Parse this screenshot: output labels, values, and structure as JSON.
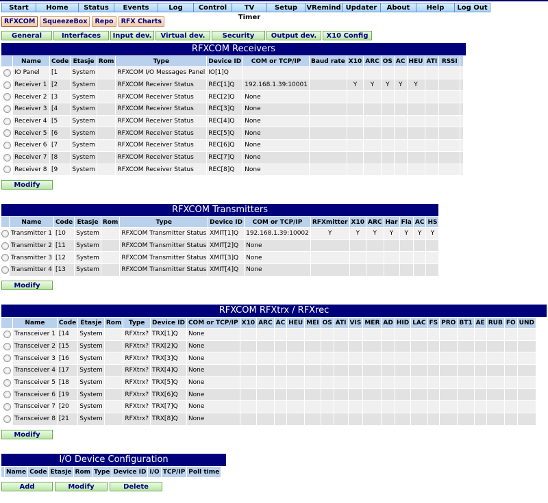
{
  "nav": [
    "Start",
    "Home",
    "Status",
    "Events",
    "Log",
    "Control",
    "TV Timer",
    "Setup",
    "VRemind",
    "Updater",
    "About",
    "Help",
    "Log Out"
  ],
  "subnav": [
    "RFXCOM",
    "SqueezeBox",
    "Repo",
    "RFX Charts"
  ],
  "tabs": [
    "General",
    "Interfaces",
    "Input dev.",
    "Virtual dev.",
    "Security",
    "Output dev.",
    "X10 Config"
  ],
  "receivers": {
    "title": "RFXCOM Receivers",
    "columns": [
      "",
      "Name",
      "Code",
      "Etasje",
      "Rom",
      "Type",
      "Device ID",
      "COM or TCP/IP",
      "Baud rate",
      "X10",
      "ARC",
      "OS",
      "AC",
      "HEU",
      "ATI",
      "RSSI",
      ""
    ],
    "rows": [
      [
        "IO Panel",
        "[1",
        "System",
        "",
        "RFXCOM I/O Messages Panel",
        "IO[1]Q",
        "",
        "",
        "",
        "",
        "",
        "",
        "",
        "",
        "",
        ""
      ],
      [
        "Receiver 1",
        "[2",
        "System",
        "",
        "RFXCOM Receiver Status",
        "REC[1]Q",
        "192.168.1.39:10001",
        "",
        "Y",
        "Y",
        "Y",
        "Y",
        "Y",
        "",
        "",
        ""
      ],
      [
        "Receiver 2",
        "[3",
        "System",
        "",
        "RFXCOM Receiver Status",
        "REC[2]Q",
        "None",
        "",
        "",
        "",
        "",
        "",
        "",
        "",
        "",
        ""
      ],
      [
        "Receiver 3",
        "[4",
        "System",
        "",
        "RFXCOM Receiver Status",
        "REC[3]Q",
        "None",
        "",
        "",
        "",
        "",
        "",
        "",
        "",
        "",
        ""
      ],
      [
        "Receiver 4",
        "[5",
        "System",
        "",
        "RFXCOM Receiver Status",
        "REC[4]Q",
        "None",
        "",
        "",
        "",
        "",
        "",
        "",
        "",
        "",
        ""
      ],
      [
        "Receiver 5",
        "[6",
        "System",
        "",
        "RFXCOM Receiver Status",
        "REC[5]Q",
        "None",
        "",
        "",
        "",
        "",
        "",
        "",
        "",
        "",
        ""
      ],
      [
        "Receiver 6",
        "[7",
        "System",
        "",
        "RFXCOM Receiver Status",
        "REC[6]Q",
        "None",
        "",
        "",
        "",
        "",
        "",
        "",
        "",
        "",
        ""
      ],
      [
        "Receiver 7",
        "[8",
        "System",
        "",
        "RFXCOM Receiver Status",
        "REC[7]Q",
        "None",
        "",
        "",
        "",
        "",
        "",
        "",
        "",
        "",
        ""
      ],
      [
        "Receiver 8",
        "[9",
        "System",
        "",
        "RFXCOM Receiver Status",
        "REC[8]Q",
        "None",
        "",
        "",
        "",
        "",
        "",
        "",
        "",
        "",
        ""
      ]
    ],
    "modify_label": "Modify"
  },
  "transmitters": {
    "title": "RFXCOM Transmitters",
    "columns": [
      "",
      "Name",
      "Code",
      "Etasje",
      "Rom",
      "Type",
      "Device ID",
      "COM or TCP/IP",
      "RFXmitter",
      "X10",
      "ARC",
      "Har",
      "Fla",
      "AC",
      "HS"
    ],
    "rows": [
      [
        "Transmitter 1",
        "[10",
        "System",
        "",
        "RFXCOM Transmitter Status",
        "XMIT[1]Q",
        "192.168.1.39:10002",
        "Y",
        "Y",
        "Y",
        "Y",
        "Y",
        "Y",
        "Y"
      ],
      [
        "Transmitter 2",
        "[11",
        "System",
        "",
        "RFXCOM Transmitter Status",
        "XMIT[2]Q",
        "None",
        "",
        "",
        "",
        "",
        "",
        "",
        ""
      ],
      [
        "Transmitter 3",
        "[12",
        "System",
        "",
        "RFXCOM Transmitter Status",
        "XMIT[3]Q",
        "None",
        "",
        "",
        "",
        "",
        "",
        "",
        ""
      ],
      [
        "Transmitter 4",
        "[13",
        "System",
        "",
        "RFXCOM Transmitter Status",
        "XMIT[4]Q",
        "None",
        "",
        "",
        "",
        "",
        "",
        "",
        ""
      ]
    ],
    "modify_label": "Modify"
  },
  "transceivers": {
    "title": "RFXCOM RFXtrx / RFXrec",
    "columns": [
      "",
      "Name",
      "Code",
      "Etasje",
      "Rom",
      "Type",
      "Device ID",
      "COM or TCP/IP",
      "X10",
      "ARC",
      "AC",
      "HEU",
      "MEI",
      "OS",
      "ATI",
      "VIS",
      "MER",
      "AD",
      "HID",
      "LAC",
      "FS",
      "PRO",
      "BT1",
      "AE",
      "RUB",
      "FO",
      "UND"
    ],
    "rows": [
      [
        "Transceiver 1",
        "[14",
        "System",
        "",
        "RFXtrx?",
        "TRX[1]Q",
        "None"
      ],
      [
        "Transceiver 2",
        "[15",
        "System",
        "",
        "RFXtrx?",
        "TRX[2]Q",
        "None"
      ],
      [
        "Transceiver 3",
        "[16",
        "System",
        "",
        "RFXtrx?",
        "TRX[3]Q",
        "None"
      ],
      [
        "Transceiver 4",
        "[17",
        "System",
        "",
        "RFXtrx?",
        "TRX[4]Q",
        "None"
      ],
      [
        "Transceiver 5",
        "[18",
        "System",
        "",
        "RFXtrx?",
        "TRX[5]Q",
        "None"
      ],
      [
        "Transceiver 6",
        "[19",
        "System",
        "",
        "RFXtrx?",
        "TRX[6]Q",
        "None"
      ],
      [
        "Transceiver 7",
        "[20",
        "System",
        "",
        "RFXtrx?",
        "TRX[7]Q",
        "None"
      ],
      [
        "Transceiver 8",
        "[21",
        "System",
        "",
        "RFXtrx?",
        "TRX[8]Q",
        "None"
      ]
    ],
    "modify_label": "Modify"
  },
  "io_config": {
    "title": "I/O Device Configuration",
    "columns": [
      "",
      "Name",
      "Code",
      "Etasje",
      "Rom",
      "Type",
      "Device ID",
      "I/O",
      "TCP/IP",
      "Poll time"
    ],
    "buttons": [
      "Add",
      "Modify",
      "Delete"
    ]
  }
}
